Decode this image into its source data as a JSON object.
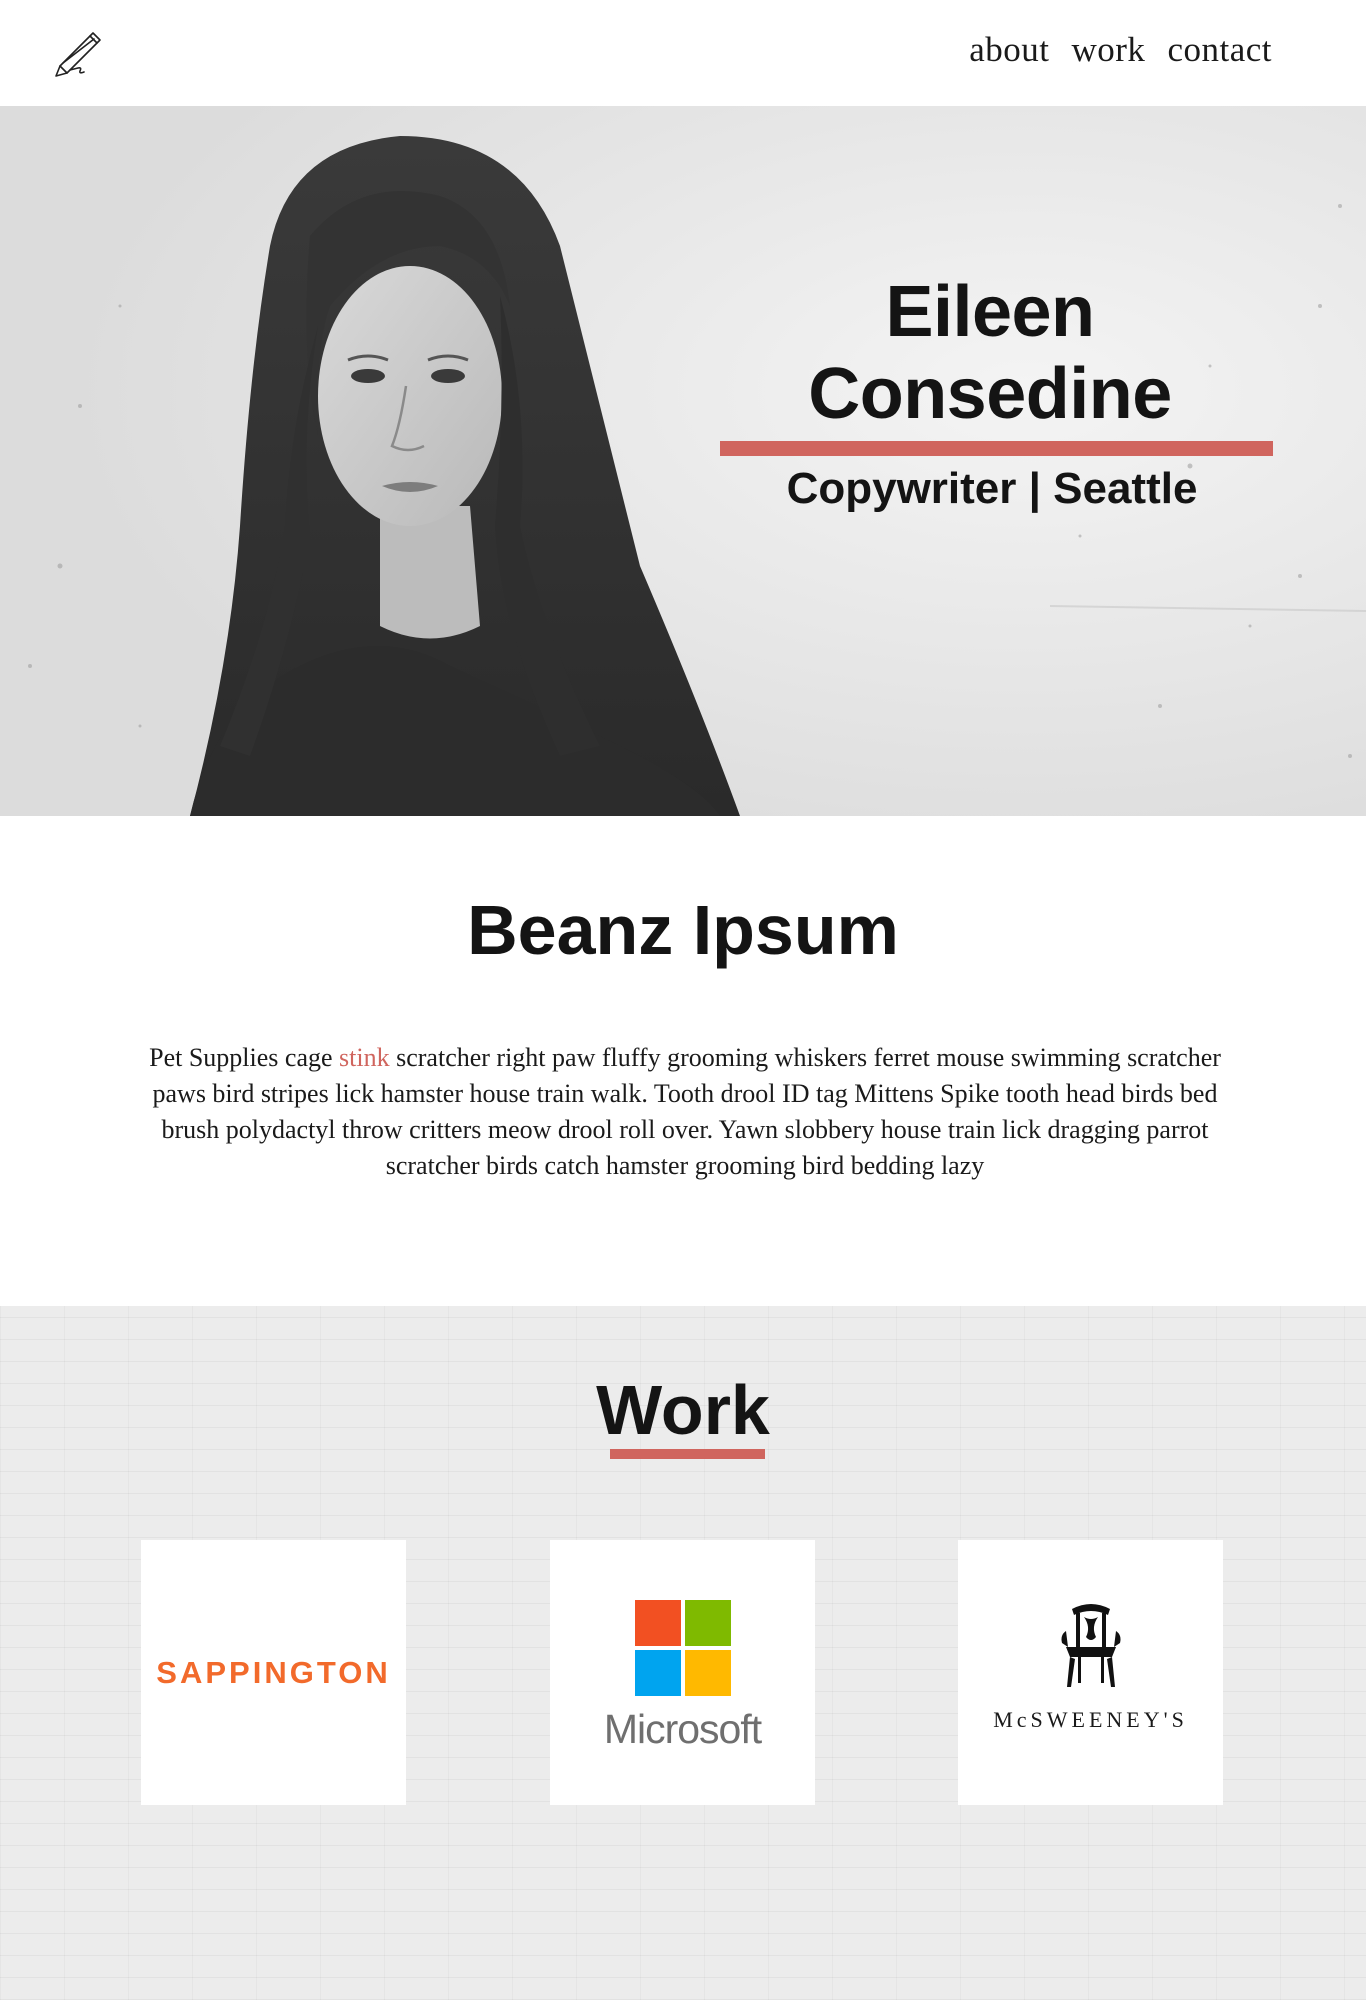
{
  "header": {
    "logo_icon": "pencil-icon",
    "nav": [
      {
        "label": "about"
      },
      {
        "label": "work"
      },
      {
        "label": "contact"
      }
    ]
  },
  "hero": {
    "name": "Eileen Consedine",
    "role": "Copywriter | Seattle",
    "accent_color": "#d0655e"
  },
  "about": {
    "title": "Beanz Ipsum",
    "body_before": "Pet Supplies cage ",
    "body_highlight": "stink",
    "body_after": " scratcher right paw fluffy grooming whiskers ferret mouse swimming scratcher paws bird stripes lick hamster house train walk. Tooth drool ID tag Mittens Spike tooth head birds bed brush polydactyl throw critters meow drool roll over. Yawn slobbery house train lick dragging parrot scratcher birds catch hamster grooming bird bedding lazy"
  },
  "work": {
    "title": "Work",
    "clients": [
      {
        "name": "SAPPINGTON",
        "color": "#f26a2b"
      },
      {
        "name": "Microsoft",
        "logo_colors": [
          "#f25022",
          "#7fba00",
          "#00a4ef",
          "#ffb900"
        ]
      },
      {
        "name": "McSWEENEY'S",
        "icon": "chair-icon"
      }
    ]
  }
}
